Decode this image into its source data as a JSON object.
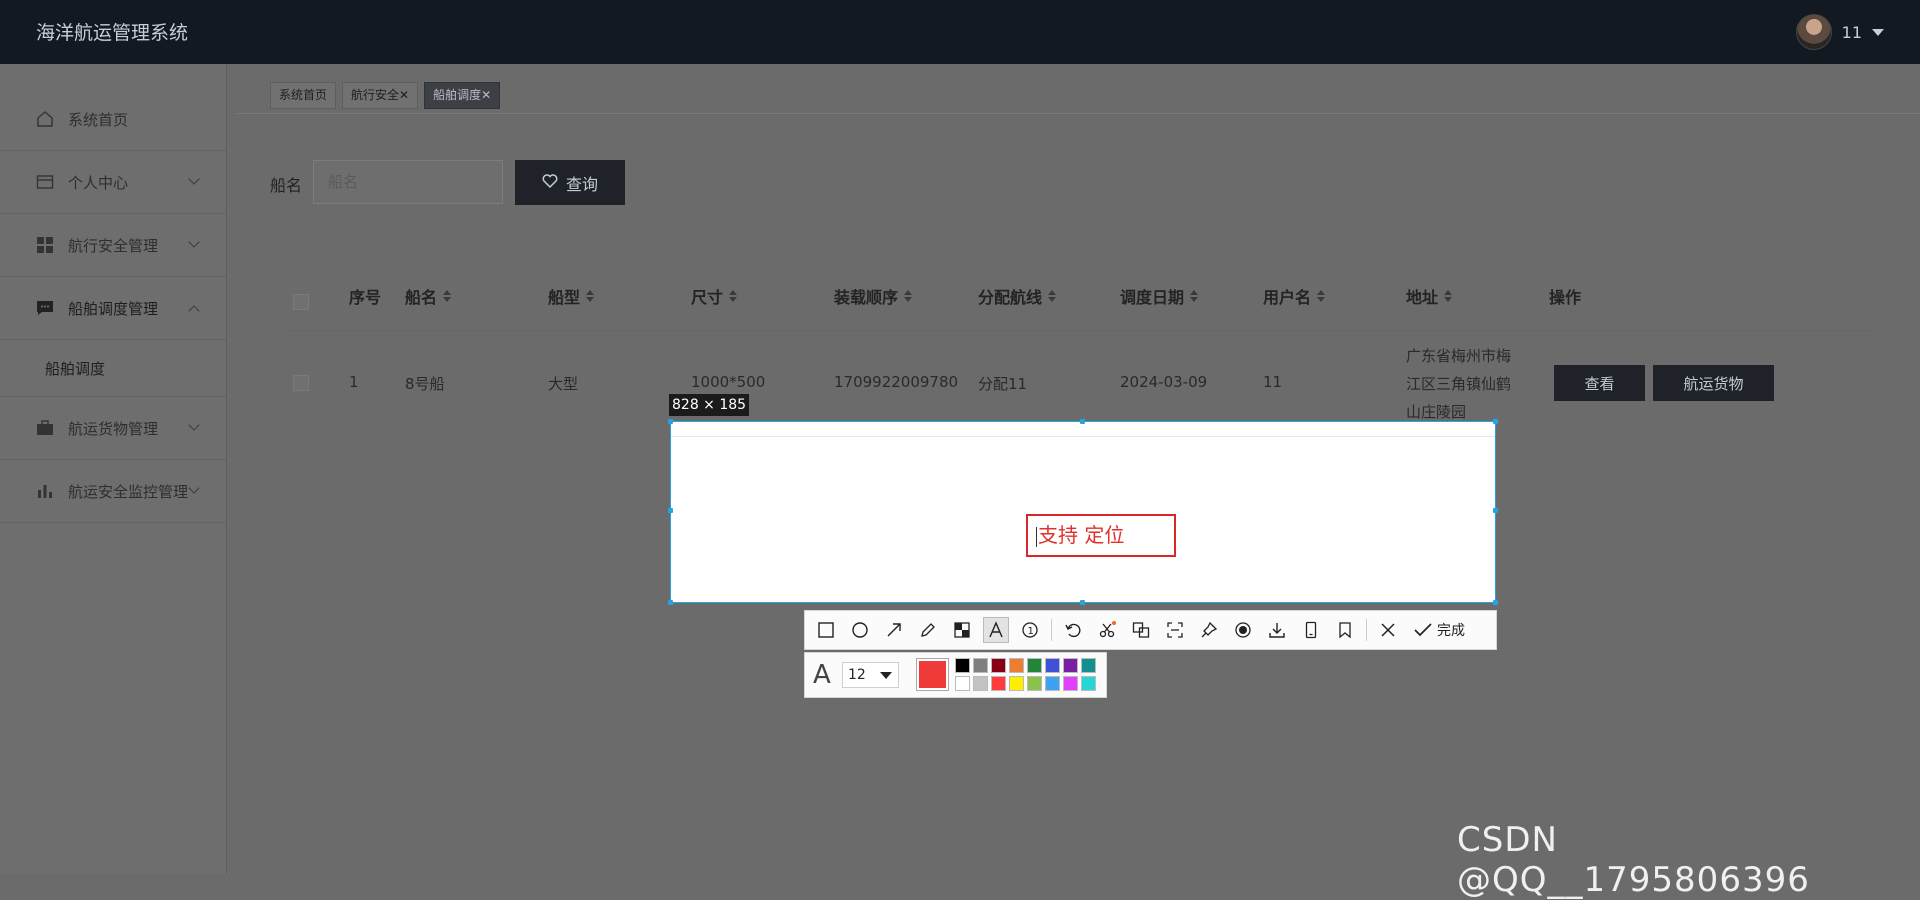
{
  "header": {
    "app_title": "海洋航运管理系统",
    "username": "11"
  },
  "sidebar": {
    "items": [
      {
        "label": "系统首页",
        "icon": "home-icon"
      },
      {
        "label": "个人中心",
        "icon": "wallet-icon",
        "expandable": true
      },
      {
        "label": "航行安全管理",
        "icon": "grid-icon",
        "expandable": true
      },
      {
        "label": "船舶调度管理",
        "icon": "message-icon",
        "expandable": true,
        "expanded": true
      },
      {
        "label": "航运货物管理",
        "icon": "briefcase-icon",
        "expandable": true
      },
      {
        "label": "航运安全监控管理",
        "icon": "bar-chart-icon",
        "expandable": true
      }
    ],
    "submenu": {
      "label": "船舶调度"
    }
  },
  "tabs": [
    {
      "label": "系统首页",
      "closable": false
    },
    {
      "label": "航行安全",
      "closable": true
    },
    {
      "label": "船舶调度",
      "closable": true,
      "active": true
    }
  ],
  "search": {
    "label": "船名",
    "placeholder": "船名",
    "button_label": "查询"
  },
  "table": {
    "columns": [
      "序号",
      "船名",
      "船型",
      "尺寸",
      "装载顺序",
      "分配航线",
      "调度日期",
      "用户名",
      "地址",
      "操作"
    ],
    "rows": [
      {
        "index": "1",
        "ship_name": "8号船",
        "ship_type": "大型",
        "size": "1000*500",
        "load_order": "1709922009780",
        "route": "分配11",
        "date": "2024-03-09",
        "user": "11",
        "address_lines": [
          "广东省梅州市梅",
          "江区三角镇仙鹤",
          "山庄陵园"
        ],
        "actions": [
          "查看",
          "航运货物"
        ]
      }
    ]
  },
  "screenshot_tool": {
    "selection_size": "828 × 185",
    "text_annotation": "支持 定位",
    "font_size": "12",
    "done_label": "完成",
    "current_color": "#f03a3a",
    "palette": [
      "#000000",
      "#7f7f7f",
      "#880015",
      "#ed7d31",
      "#22863a",
      "#3f51d8",
      "#7b1fa2",
      "#138f8f",
      "#ffffff",
      "#c3c3c3",
      "#ff3b3b",
      "#ffee00",
      "#8bc34a",
      "#3fa2f0",
      "#e040fb",
      "#26d6d6"
    ],
    "tools": [
      "rectangle-icon",
      "ellipse-icon",
      "arrow-icon",
      "pencil-icon",
      "mosaic-icon",
      "text-icon",
      "number-icon",
      "undo-icon",
      "scissors-icon",
      "translate-icon",
      "scan-icon",
      "pin-icon",
      "record-icon",
      "download-icon",
      "phone-icon",
      "bookmark-icon"
    ]
  },
  "watermark": "CSDN @QQ__1795806396"
}
